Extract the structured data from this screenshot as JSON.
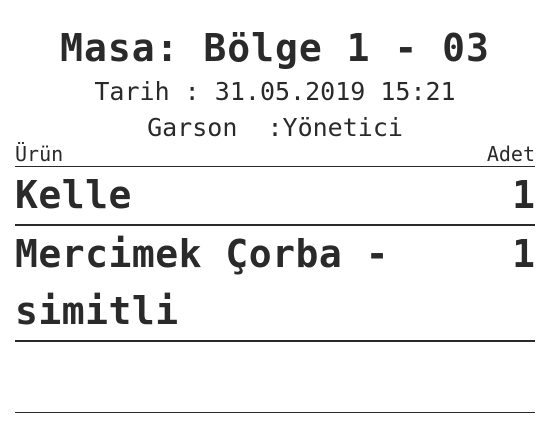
{
  "receipt": {
    "table_title": "Masa: Bölge 1 - 03",
    "date_line": "Tarih : 31.05.2019 15:21",
    "waiter_line": "Garson  :Yönetici",
    "columns": {
      "product": "Ürün",
      "quantity": "Adet"
    },
    "items": [
      {
        "name": "Kelle",
        "quantity": "1"
      },
      {
        "name": "Mercimek Çorba - simitli",
        "quantity": "1"
      }
    ]
  }
}
